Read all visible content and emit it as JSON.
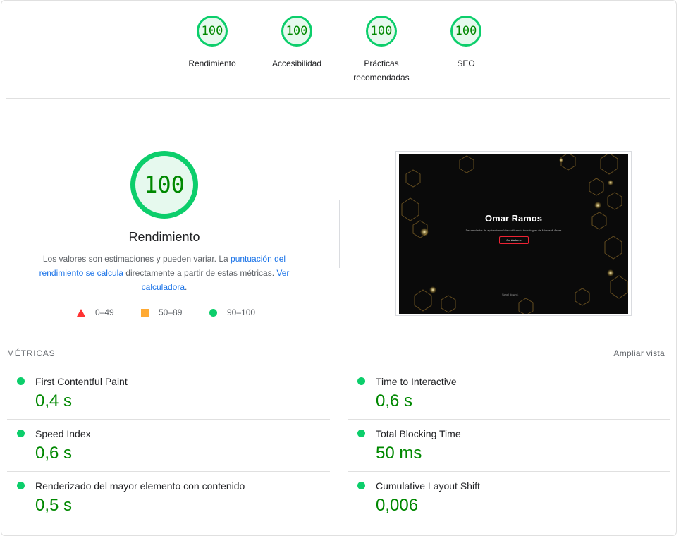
{
  "categories": [
    {
      "score": "100",
      "label": "Rendimiento"
    },
    {
      "score": "100",
      "label": "Accesibilidad"
    },
    {
      "score": "100",
      "label": "Prácticas recomendadas"
    },
    {
      "score": "100",
      "label": "SEO"
    }
  ],
  "performance": {
    "score": "100",
    "title": "Rendimiento",
    "desc_1": "Los valores son estimaciones y pueden variar. La ",
    "link_1": "puntuación del rendimiento se calcula",
    "desc_2": " directamente a partir de estas métricas. ",
    "link_2": "Ver calculadora",
    "desc_3": "."
  },
  "legend": [
    {
      "shape": "triangle",
      "range": "0–49",
      "color": "#ff3333"
    },
    {
      "shape": "square",
      "range": "50–89",
      "color": "#ffaa33"
    },
    {
      "shape": "circle",
      "range": "90–100",
      "color": "#0cce6b"
    }
  ],
  "screenshot": {
    "title": "Omar Ramos",
    "subtitle": "Desarrollador de aplicaciones Web utilizando tecnologías de Microsoft Azure",
    "button": "Contáctame",
    "scroll": "Scroll down ↓"
  },
  "metrics": {
    "title": "MÉTRICAS",
    "expand": "Ampliar vista",
    "items": [
      {
        "name": "First Contentful Paint",
        "value": "0,4 s"
      },
      {
        "name": "Time to Interactive",
        "value": "0,6 s"
      },
      {
        "name": "Speed Index",
        "value": "0,6 s"
      },
      {
        "name": "Total Blocking Time",
        "value": "50 ms"
      },
      {
        "name": "Renderizado del mayor elemento con contenido",
        "value": "0,5 s"
      },
      {
        "name": "Cumulative Layout Shift",
        "value": "0,006"
      }
    ]
  },
  "colors": {
    "pass": "#0cce6b",
    "pass_text": "#008800",
    "link": "#1a73e8"
  }
}
